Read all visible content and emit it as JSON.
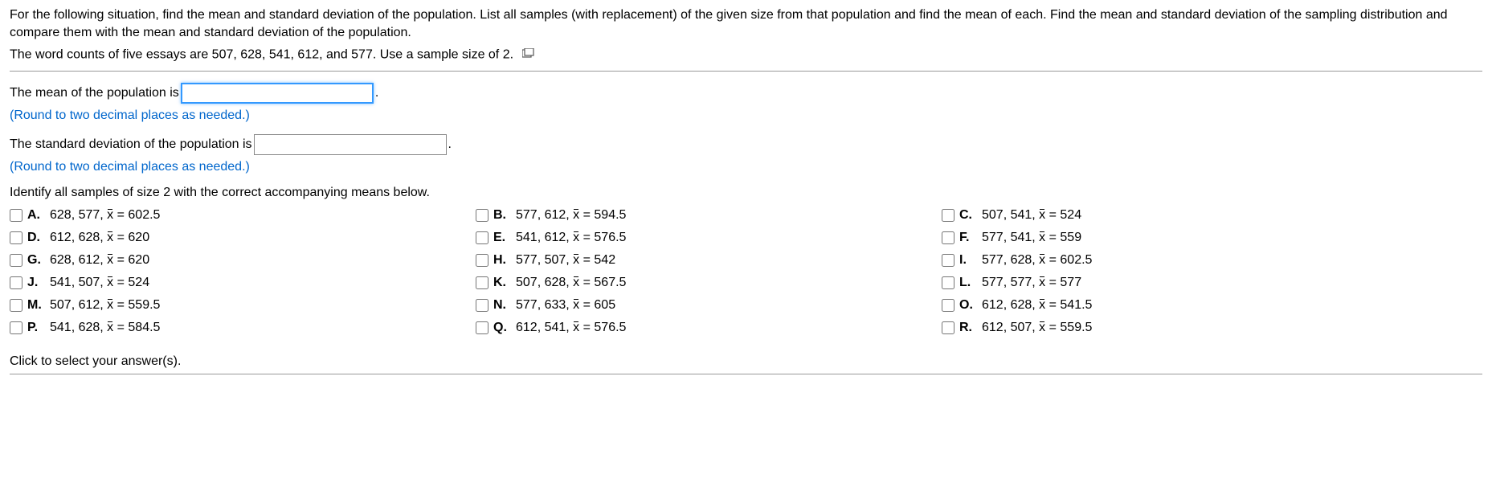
{
  "problem": {
    "line1": "For the following situation, find the mean and standard deviation of the population. List all samples (with replacement) of the given size from that population and find the mean of each. Find the mean and standard deviation of the sampling distribution and compare them with the mean and standard deviation of the population.",
    "line2_prefix": "The word counts of five essays are 507, 628, 541, 612, and 577. Use a sample size of 2."
  },
  "prompt_mean_prefix": "The mean of the population is ",
  "prompt_mean_suffix": ".",
  "hint_round": "(Round to two decimal places as needed.)",
  "prompt_sd_prefix": "The standard deviation of the population is ",
  "prompt_sd_suffix": ".",
  "identify": "Identify all samples of size 2 with the correct accompanying means below.",
  "options": [
    {
      "letter": "A.",
      "label": "628, 577, x̄ = 602.5"
    },
    {
      "letter": "B.",
      "label": "577, 612, x̄ = 594.5"
    },
    {
      "letter": "C.",
      "label": "507, 541, x̄ = 524"
    },
    {
      "letter": "D.",
      "label": "612, 628, x̄ = 620"
    },
    {
      "letter": "E.",
      "label": "541, 612, x̄ = 576.5"
    },
    {
      "letter": "F.",
      "label": "577, 541, x̄ = 559"
    },
    {
      "letter": "G.",
      "label": "628, 612, x̄ = 620"
    },
    {
      "letter": "H.",
      "label": "577, 507, x̄ = 542"
    },
    {
      "letter": "I.",
      "label": "577, 628, x̄ = 602.5"
    },
    {
      "letter": "J.",
      "label": "541, 507, x̄ = 524"
    },
    {
      "letter": "K.",
      "label": "507, 628, x̄ = 567.5"
    },
    {
      "letter": "L.",
      "label": "577, 577, x̄ = 577"
    },
    {
      "letter": "M.",
      "label": "507, 612, x̄ = 559.5"
    },
    {
      "letter": "N.",
      "label": "577, 633, x̄ = 605"
    },
    {
      "letter": "O.",
      "label": "612, 628, x̄ = 541.5"
    },
    {
      "letter": "P.",
      "label": "541, 628, x̄ = 584.5"
    },
    {
      "letter": "Q.",
      "label": "612, 541, x̄ = 576.5"
    },
    {
      "letter": "R.",
      "label": "612, 507, x̄ = 559.5"
    }
  ],
  "footer": "Click to select your answer(s).",
  "chart_data": {
    "type": "table",
    "population_values": [
      507,
      628,
      541,
      612,
      577
    ],
    "sample_size": 2,
    "options": [
      {
        "letter": "A",
        "sample": [
          628,
          577
        ],
        "xbar": 602.5
      },
      {
        "letter": "B",
        "sample": [
          577,
          612
        ],
        "xbar": 594.5
      },
      {
        "letter": "C",
        "sample": [
          507,
          541
        ],
        "xbar": 524
      },
      {
        "letter": "D",
        "sample": [
          612,
          628
        ],
        "xbar": 620
      },
      {
        "letter": "E",
        "sample": [
          541,
          612
        ],
        "xbar": 576.5
      },
      {
        "letter": "F",
        "sample": [
          577,
          541
        ],
        "xbar": 559
      },
      {
        "letter": "G",
        "sample": [
          628,
          612
        ],
        "xbar": 620
      },
      {
        "letter": "H",
        "sample": [
          577,
          507
        ],
        "xbar": 542
      },
      {
        "letter": "I",
        "sample": [
          577,
          628
        ],
        "xbar": 602.5
      },
      {
        "letter": "J",
        "sample": [
          541,
          507
        ],
        "xbar": 524
      },
      {
        "letter": "K",
        "sample": [
          507,
          628
        ],
        "xbar": 567.5
      },
      {
        "letter": "L",
        "sample": [
          577,
          577
        ],
        "xbar": 577
      },
      {
        "letter": "M",
        "sample": [
          507,
          612
        ],
        "xbar": 559.5
      },
      {
        "letter": "N",
        "sample": [
          577,
          633
        ],
        "xbar": 605
      },
      {
        "letter": "O",
        "sample": [
          612,
          628
        ],
        "xbar": 541.5
      },
      {
        "letter": "P",
        "sample": [
          541,
          628
        ],
        "xbar": 584.5
      },
      {
        "letter": "Q",
        "sample": [
          612,
          541
        ],
        "xbar": 576.5
      },
      {
        "letter": "R",
        "sample": [
          612,
          507
        ],
        "xbar": 559.5
      }
    ]
  }
}
